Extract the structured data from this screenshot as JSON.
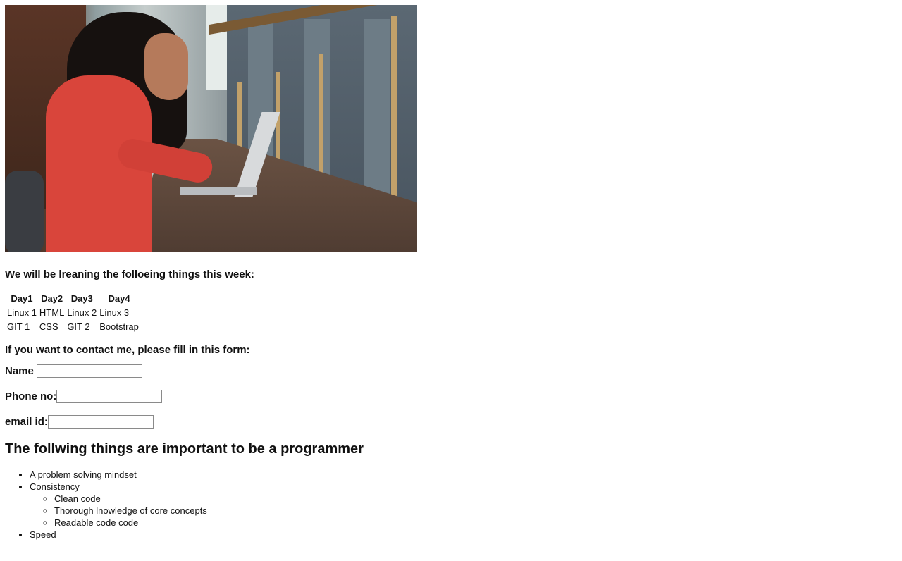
{
  "hero": {
    "image_alt": "woman working on laptop"
  },
  "intro_text": "We will be lreaning the folloeing things this week:",
  "schedule": {
    "headers": [
      "Day1",
      "Day2",
      "Day3",
      "Day4"
    ],
    "rows": [
      [
        "Linux 1",
        "HTML",
        "Linux 2",
        "Linux 3"
      ],
      [
        "GIT 1",
        "CSS",
        "GIT 2",
        "Bootstrap"
      ]
    ]
  },
  "contact": {
    "heading": "If you want to contact me, please fill in this form:",
    "name_label": "Name",
    "name_value": "",
    "phone_label": "Phone no:",
    "phone_value": "",
    "email_label": "email id:",
    "email_value": ""
  },
  "programmer": {
    "heading": "The follwing things are important to be a programmer",
    "items": {
      "mindset": "A problem solving mindset",
      "consistency": "Consistency",
      "sub": [
        "Clean code",
        "Thorough lnowledge of core concepts",
        "Readable code code"
      ],
      "speed": "Speed"
    }
  }
}
